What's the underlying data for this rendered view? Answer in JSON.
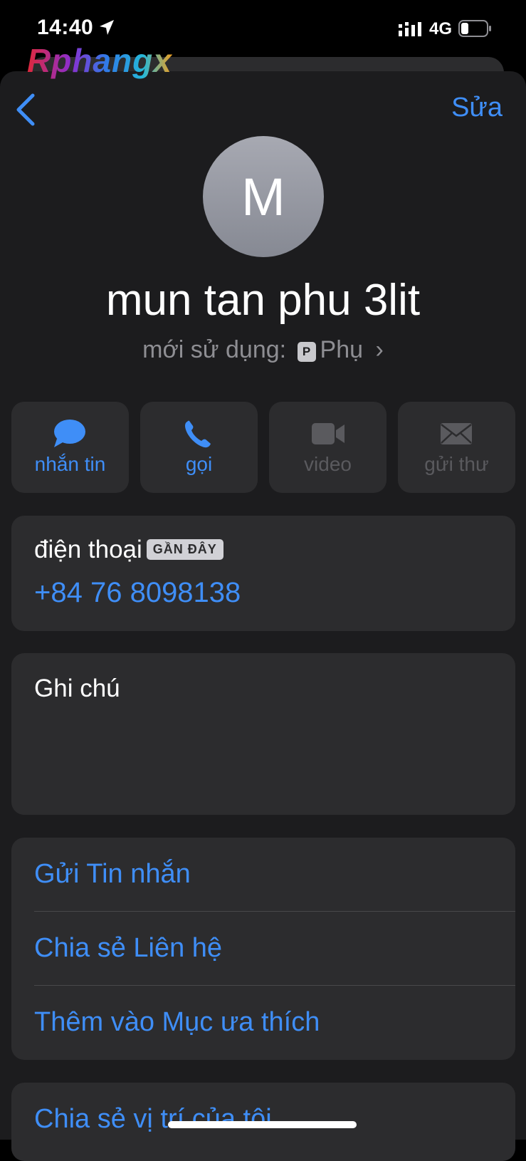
{
  "status_bar": {
    "time": "14:40",
    "network": "4G"
  },
  "watermark": "Rphangx",
  "nav": {
    "edit_label": "Sửa"
  },
  "contact": {
    "avatar_initial": "M",
    "name": "mun tan phu 3lit",
    "recent_prefix": "mới sử dụng:",
    "line_badge": "P",
    "line_name": "Phụ",
    "chevron": "›"
  },
  "actions": [
    {
      "label": "nhắn tin",
      "icon": "message-icon",
      "enabled": true
    },
    {
      "label": "gọi",
      "icon": "phone-icon",
      "enabled": true
    },
    {
      "label": "video",
      "icon": "video-icon",
      "enabled": false
    },
    {
      "label": "gửi thư",
      "icon": "mail-icon",
      "enabled": false
    }
  ],
  "phone": {
    "label": "điện thoại",
    "badge": "GẦN ĐÂY",
    "number": "+84 76 8098138"
  },
  "notes": {
    "label": "Ghi chú"
  },
  "options": [
    "Gửi Tin nhắn",
    "Chia sẻ Liên hệ",
    "Thêm vào Mục ưa thích"
  ],
  "location": {
    "label": "Chia sẻ vị trí của tôi"
  },
  "colors": {
    "accent": "#3f8ef7",
    "sheet": "#1c1c1e",
    "card": "#2c2c2e",
    "secondary_text": "#8e8e93"
  }
}
